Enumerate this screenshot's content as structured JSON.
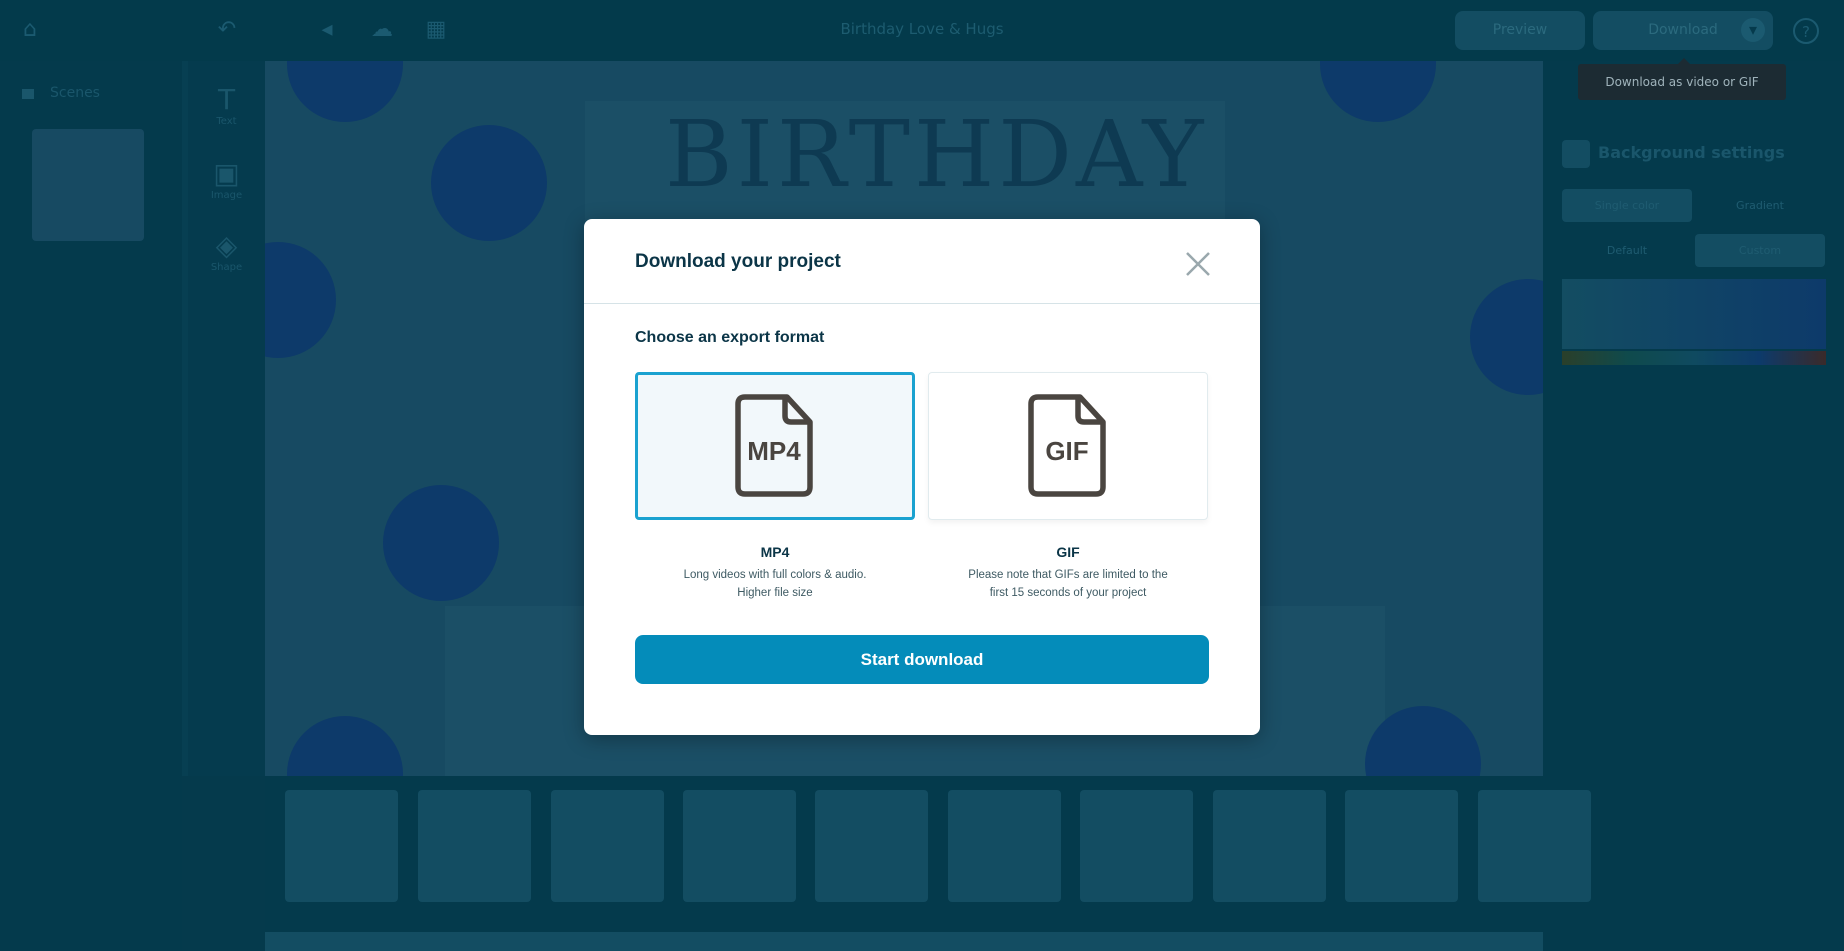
{
  "topbar": {
    "title": "Birthday Love & Hugs",
    "preview": "Preview",
    "download": "Download",
    "tooltip": "Download as video or GIF"
  },
  "sidebar": {
    "scenes": "Scenes"
  },
  "tools": [
    {
      "label": "Text",
      "icon": "text-icon"
    },
    {
      "label": "Image",
      "icon": "image-icon"
    },
    {
      "label": "Shape",
      "icon": "shape-icon"
    }
  ],
  "canvas": {
    "headline": "BIRTHDAY"
  },
  "right_panel": {
    "title": "Background settings",
    "tabs": [
      "Single color",
      "Gradient"
    ],
    "modes": [
      "Default",
      "Custom"
    ]
  },
  "dialog": {
    "title": "Download your project",
    "section": "Choose an export format",
    "formats": [
      {
        "icon_text": "MP4",
        "label": "MP4",
        "desc1": "Long videos with full colors & audio.",
        "desc2": "Higher file size",
        "selected": true
      },
      {
        "icon_text": "GIF",
        "label": "GIF",
        "desc1": "Please note that GIFs are limited to the",
        "desc2": "first 15 seconds of your project",
        "selected": false
      }
    ],
    "start": "Start download"
  },
  "colors": {
    "accent": "#048cba",
    "selected_border": "#1ba2d0",
    "title": "#0b3547"
  }
}
